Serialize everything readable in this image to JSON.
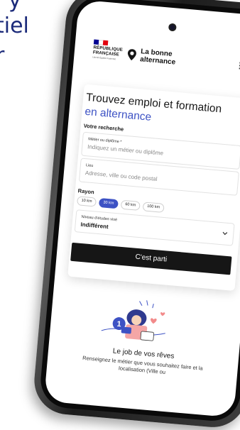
{
  "background_text": {
    "line1": "y",
    "line2": "tiel",
    "line3": "r"
  },
  "header": {
    "republic_name": "RÉPUBLIQUE FRANÇAISE",
    "republic_line1": "RÉPUBLIQUE",
    "republic_line2": "FRANÇAISE",
    "motto": "Liberté Égalité Fraternité",
    "brand_line1": "La bonne",
    "brand_line2": "alternance",
    "flag_colors": [
      "#000091",
      "#ffffff",
      "#e1000f"
    ]
  },
  "search": {
    "title": "Trouvez emploi et formation",
    "subtitle": "en alternance",
    "section_label": "Votre recherche",
    "job_field_label": "Métier ou diplôme *",
    "job_field_placeholder": "Indiquez un métier ou diplôme",
    "location_field_label": "Lieu",
    "location_field_placeholder": "Adresse, ville ou code postal",
    "radius_label": "Rayon",
    "radius_options": [
      "10 km",
      "30 km",
      "60 km",
      "100 km"
    ],
    "radius_selected": "30 km",
    "level_label": "Niveau d'études visé",
    "level_value": "Indifférent",
    "submit_label": "C'est parti"
  },
  "feature": {
    "step_number": "1",
    "title": "Le job de vos rêves",
    "text": "Renseignez le métier que vous souhaitez faire et la localisation (Ville ou"
  },
  "colors": {
    "accent": "#3d52c4",
    "button": "#161616",
    "brand_blue": "#1b2a7a"
  }
}
